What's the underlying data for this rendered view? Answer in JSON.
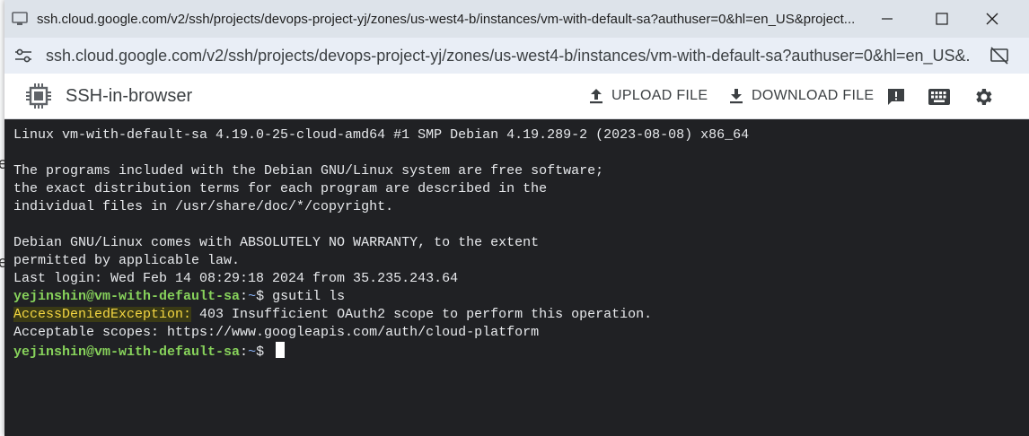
{
  "browser": {
    "title": "ssh.cloud.google.com/v2/ssh/projects/devops-project-yj/zones/us-west4-b/instances/vm-with-default-sa?authuser=0&hl=en_US&project...",
    "url": "ssh.cloud.google.com/v2/ssh/projects/devops-project-yj/zones/us-west4-b/instances/vm-with-default-sa?authuser=0&hl=en_US&..."
  },
  "app": {
    "title": "SSH-in-browser",
    "upload_label": "UPLOAD FILE",
    "download_label": "DOWNLOAD FILE"
  },
  "terminal": {
    "line1": "Linux vm-with-default-sa 4.19.0-25-cloud-amd64 #1 SMP Debian 4.19.289-2 (2023-08-08) x86_64",
    "line3": "The programs included with the Debian GNU/Linux system are free software;",
    "line4": "the exact distribution terms for each program are described in the",
    "line5": "individual files in /usr/share/doc/*/copyright.",
    "line7": "Debian GNU/Linux comes with ABSOLUTELY NO WARRANTY, to the extent",
    "line8": "permitted by applicable law.",
    "line9": "Last login: Wed Feb 14 08:29:18 2024 from 35.235.243.64",
    "prompt_user": "yejinshin@vm-with-default-sa",
    "prompt_colon": ":",
    "prompt_dir": "~",
    "prompt_sign": "$ ",
    "command": "gsutil ls",
    "error_label": "AccessDeniedException:",
    "error_text": " 403 Insufficient OAuth2 scope to perform this operation.",
    "scopes_line": "Acceptable scopes: https://www.googleapis.com/auth/cloud-platform"
  },
  "colors": {
    "terminal_bg": "#202124",
    "prompt": "#87d25b",
    "error_highlight": "#f5d742"
  }
}
